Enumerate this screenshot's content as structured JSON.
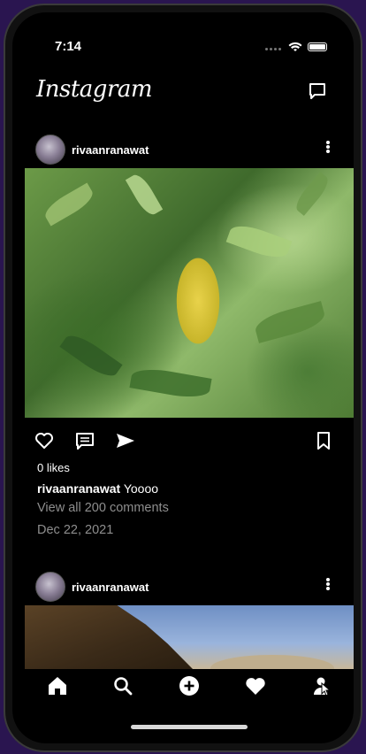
{
  "status_bar": {
    "time": "7:14"
  },
  "header": {
    "logo_text": "Instagram",
    "messages_icon": "direct-message-icon"
  },
  "posts": [
    {
      "username": "rivaanranawat",
      "likes": "0 likes",
      "caption_user": "rivaanranawat",
      "caption_text": "Yoooo",
      "view_comments": "View all 200 comments",
      "date": "Dec 22, 2021"
    },
    {
      "username": "rivaanranawat"
    }
  ],
  "actions": {
    "like_icon": "heart-outline-icon",
    "comment_icon": "comment-icon",
    "share_icon": "send-icon",
    "save_icon": "bookmark-icon"
  },
  "bottom_nav": {
    "items": [
      "home-icon",
      "search-icon",
      "add-icon",
      "heart-icon",
      "profile-icon"
    ]
  },
  "colors": {
    "background": "#000000",
    "text": "#ffffff",
    "secondary_text": "#8e8e8e"
  }
}
